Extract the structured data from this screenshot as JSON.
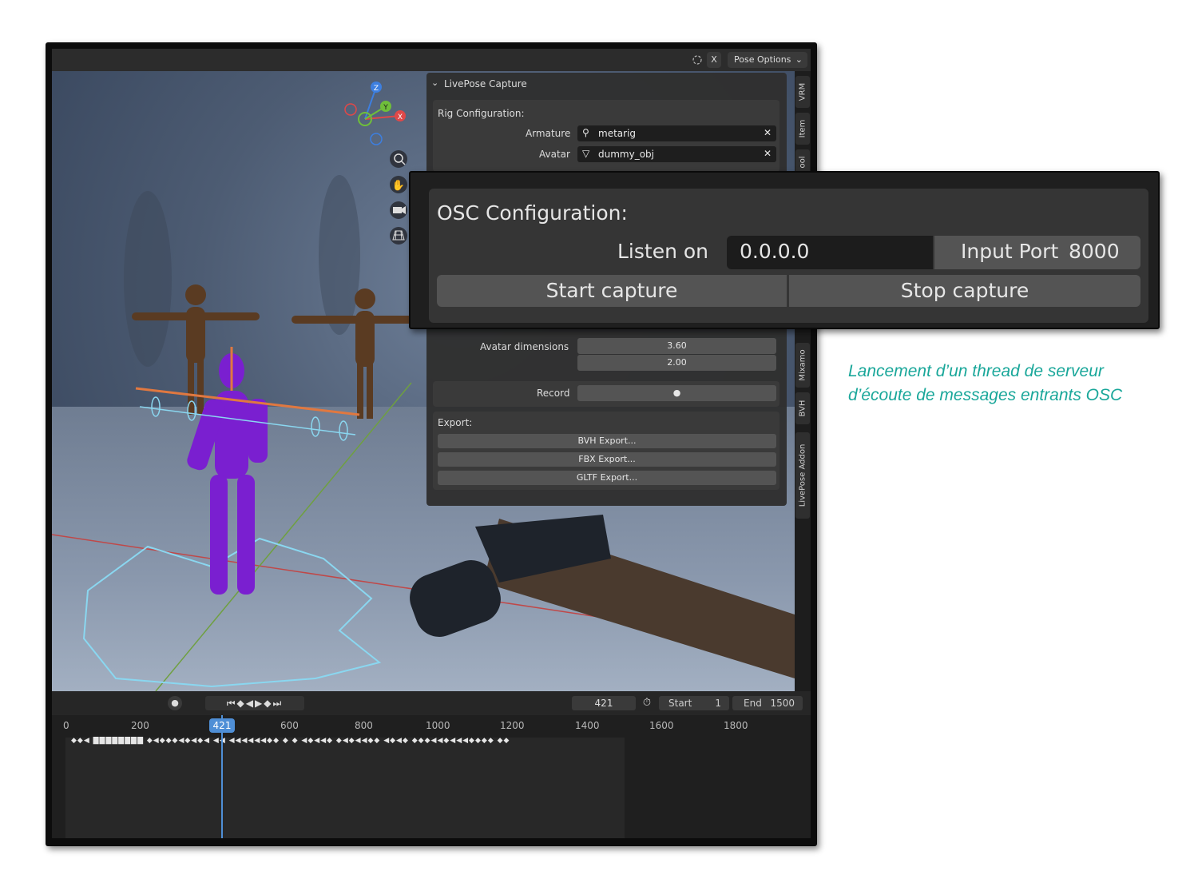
{
  "header": {
    "close_label": "X",
    "pose_options_label": "Pose Options",
    "colors": {
      "bar": "#2c2c2c"
    }
  },
  "sidebar_tabs": [
    "VRM",
    "Item",
    "ool",
    "Mixamo",
    "BVH",
    "LivePose Addon"
  ],
  "panel": {
    "title": "LivePose Capture",
    "rig_configuration": {
      "heading": "Rig Configuration:",
      "armature_label": "Armature",
      "armature_value": "metarig",
      "avatar_label": "Avatar",
      "avatar_value": "dummy_obj"
    },
    "avatar_dimensions": {
      "label": "Avatar dimensions",
      "values": [
        "3.60",
        "2.00"
      ]
    },
    "record_label": "Record",
    "export": {
      "heading": "Export:",
      "buttons": [
        "BVH Export...",
        "FBX Export...",
        "GLTF Export..."
      ]
    }
  },
  "timeline": {
    "current_frame": "421",
    "start_label": "Start",
    "start_value": "1",
    "end_label": "End",
    "end_value": "1500",
    "ruler_labels": [
      "0",
      "200",
      "421",
      "600",
      "800",
      "1000",
      "1200",
      "1400",
      "1600",
      "1800"
    ]
  },
  "osc_popup": {
    "heading": "OSC Configuration:",
    "listen_on_label": "Listen on",
    "listen_on_value": "0.0.0.0",
    "input_port_label": "Input Port",
    "input_port_value": "8000",
    "start_button": "Start capture",
    "stop_button": "Stop capture"
  },
  "caption": {
    "line1": "Lancement d’un thread de serveur",
    "line2": "d’écoute de messages entrants OSC",
    "color": "#1aa79a"
  },
  "viewport": {
    "gizmo_axes": [
      "Z",
      "Y",
      "X"
    ],
    "nav_icons": [
      "zoom-icon",
      "hand-icon",
      "camera-icon",
      "grid-icon"
    ]
  }
}
